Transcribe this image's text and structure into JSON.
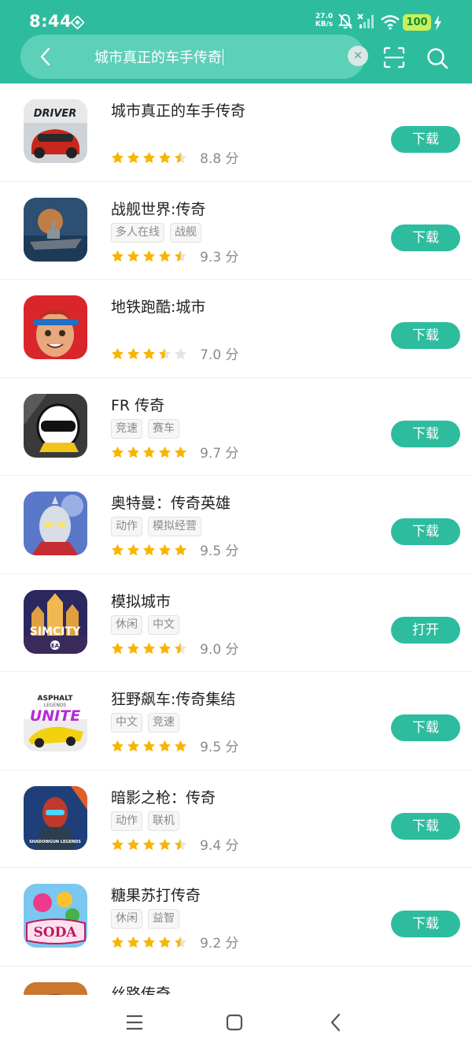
{
  "status_bar": {
    "time": "8:44",
    "net_speed_value": "27.0",
    "net_speed_unit": "KB/s",
    "battery": "100",
    "icons": [
      "vpn-diamond-icon",
      "mute-icon",
      "signal-off-icon",
      "wifi-icon",
      "battery-icon",
      "charging-icon"
    ]
  },
  "search": {
    "query": "城市真正的车手传奇",
    "icons": [
      "back-icon",
      "clear-icon",
      "scan-icon",
      "search-icon"
    ],
    "accent": "#2ebc9f"
  },
  "apps": [
    {
      "title": "城市真正的车手传奇",
      "tags": [],
      "rating": 4.5,
      "score": "8.8 分",
      "action": "下载",
      "icon": "driver-game-icon"
    },
    {
      "title": "战舰世界:传奇",
      "tags": [
        "多人在线",
        "战舰"
      ],
      "rating": 4.5,
      "score": "9.3 分",
      "action": "下载",
      "icon": "warship-game-icon"
    },
    {
      "title": "地铁跑酷:城市",
      "tags": [],
      "rating": 3.5,
      "score": "7.0 分",
      "action": "下载",
      "icon": "subway-surfers-icon"
    },
    {
      "title": "FR 传奇",
      "tags": [
        "竞速",
        "赛车"
      ],
      "rating": 5,
      "score": "9.7 分",
      "action": "下载",
      "icon": "fr-legends-helmet-icon"
    },
    {
      "title": "奥特曼：传奇英雄",
      "tags": [
        "动作",
        "模拟经营"
      ],
      "rating": 5,
      "score": "9.5 分",
      "action": "下载",
      "icon": "ultraman-icon"
    },
    {
      "title": "模拟城市",
      "tags": [
        "休闲",
        "中文"
      ],
      "rating": 4.5,
      "score": "9.0 分",
      "action": "打开",
      "icon": "simcity-icon"
    },
    {
      "title": "狂野飙车:传奇集结",
      "tags": [
        "中文",
        "竞速"
      ],
      "rating": 5,
      "score": "9.5 分",
      "action": "下载",
      "icon": "asphalt-unite-icon"
    },
    {
      "title": "暗影之枪：传奇",
      "tags": [
        "动作",
        "联机"
      ],
      "rating": 4.5,
      "score": "9.4 分",
      "action": "下载",
      "icon": "shadowgun-icon"
    },
    {
      "title": "糖果苏打传奇",
      "tags": [
        "休闲",
        "益智"
      ],
      "rating": 4.5,
      "score": "9.2 分",
      "action": "下载",
      "icon": "candy-soda-icon"
    },
    {
      "title": "丝路传奇",
      "tags": [],
      "rating": 0,
      "score": "",
      "action": "",
      "icon": "silk-road-icon"
    }
  ],
  "icon_text": {
    "driver": "DRIVER",
    "simcity": "SIMCITY",
    "ea": "EA",
    "asphalt": "ASPHALT",
    "legends": "LEGENDS",
    "unite": "UNITE",
    "shadowgun": "SHADOWGUN LEGENDS",
    "soda": "SODA"
  },
  "colors": {
    "star": "#f7b500",
    "star_empty": "#e3e3e3",
    "tag_text": "#8a8a8a"
  },
  "nav_bar": {
    "icons": [
      "menu-icon",
      "home-icon",
      "back-nav-icon"
    ]
  }
}
